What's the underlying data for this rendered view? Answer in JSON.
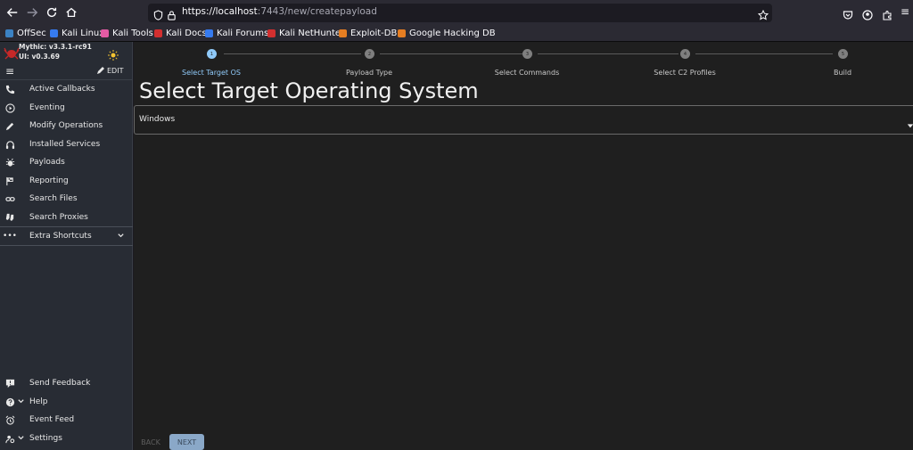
{
  "browser": {
    "url_host": "https://localhost",
    "url_rest": ":7443/new/createpayload",
    "bookmarks": [
      {
        "label": "OffSec",
        "color": "#3b82c4"
      },
      {
        "label": "Kali Linux",
        "color": "#367bf0"
      },
      {
        "label": "Kali Tools",
        "color": "#e35ba4"
      },
      {
        "label": "Kali Docs",
        "color": "#d32f2f"
      },
      {
        "label": "Kali Forums",
        "color": "#367bf0"
      },
      {
        "label": "Kali NetHunter",
        "color": "#d32f2f"
      },
      {
        "label": "Exploit-DB",
        "color": "#e67e22"
      },
      {
        "label": "Google Hacking DB",
        "color": "#e67e22"
      }
    ]
  },
  "app": {
    "version_mythic": "Mythic: v3.3.1-rc91",
    "version_ui": "UI: v0.3.69",
    "edit_label": "EDIT",
    "nav": [
      {
        "label": "Active Callbacks",
        "icon": "phone-icon"
      },
      {
        "label": "Eventing",
        "icon": "play-circle-icon"
      },
      {
        "label": "Modify Operations",
        "icon": "pencil-icon"
      },
      {
        "label": "Installed Services",
        "icon": "headphones-icon"
      },
      {
        "label": "Payloads",
        "icon": "bug-icon"
      },
      {
        "label": "Reporting",
        "icon": "flag-icon"
      },
      {
        "label": "Search Files",
        "icon": "link-icon"
      },
      {
        "label": "Search Proxies",
        "icon": "socks-icon"
      },
      {
        "label": "Extra Shortcuts",
        "icon": "more-icon"
      }
    ],
    "bottom_nav": [
      {
        "label": "Send Feedback",
        "icon": "feedback-icon"
      },
      {
        "label": "Help",
        "icon": "help-icon"
      },
      {
        "label": "Event Feed",
        "icon": "alarm-icon"
      },
      {
        "label": "Settings",
        "icon": "settings-icon"
      }
    ]
  },
  "wizard": {
    "steps": [
      {
        "number": "1",
        "label": "Select Target OS"
      },
      {
        "number": "2",
        "label": "Payload Type"
      },
      {
        "number": "3",
        "label": "Select Commands"
      },
      {
        "number": "4",
        "label": "Select C2 Profiles"
      },
      {
        "number": "5",
        "label": "Build"
      }
    ],
    "title": "Select Target Operating System",
    "os_value": "Windows",
    "back_label": "BACK",
    "next_label": "NEXT"
  }
}
